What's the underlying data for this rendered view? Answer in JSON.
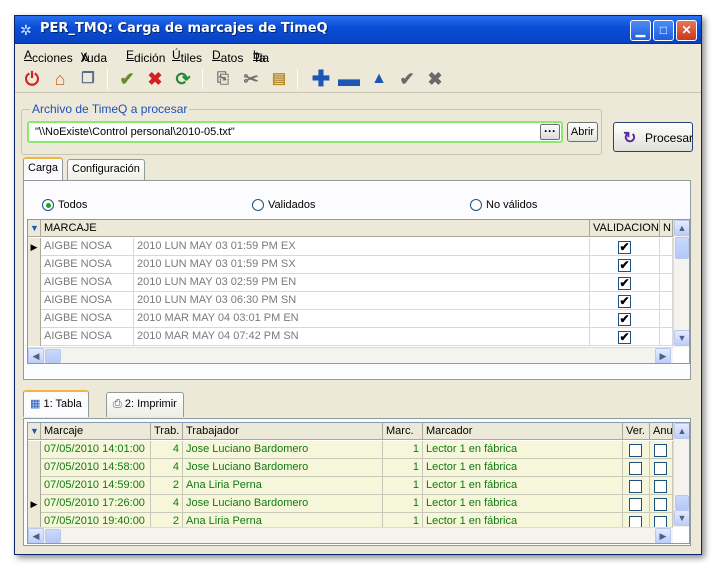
{
  "window": {
    "title": "PER_TMQ: Carga de marcajes de TimeQ"
  },
  "menu": [
    {
      "pre": "",
      "u": "A",
      "post": "cciones"
    },
    {
      "pre": "A",
      "u": "y",
      "post": "uda"
    },
    {
      "pre": "",
      "u": "E",
      "post": "dición"
    },
    {
      "pre": "",
      "u": "Ú",
      "post": "tiles"
    },
    {
      "pre": "",
      "u": "D",
      "post": "atos"
    },
    {
      "pre": "Ta",
      "u": "b",
      "post": "la"
    }
  ],
  "toolbar": [
    "power-icon",
    "home-icon",
    "windows-icon",
    "approve-all-icon",
    "reject-all-icon",
    "refresh-icon",
    "copy-icon",
    "cut-icon",
    "paste-icon",
    "add-icon",
    "remove-icon",
    "up-icon",
    "accept-icon",
    "cancel-icon"
  ],
  "archivo": {
    "label": "Archivo de TimeQ a procesar",
    "path": "\"\\\\NoExiste\\Control personal\\2010-05.txt\"",
    "ellipsis": "···",
    "abrir": "Abrir"
  },
  "procesar": "Procesar",
  "tabs_top": [
    "Carga",
    "Configuración"
  ],
  "filtros": {
    "todos": "Todos",
    "validados": "Validados",
    "no_validos": "No válidos"
  },
  "grid1": {
    "headers": {
      "marcaje": "MARCAJE",
      "validacion": "VALIDACION",
      "n": "N"
    },
    "rows": [
      {
        "nombre": "AIGBE NOSA",
        "fecha": "2010 LUN MAY 03 01:59 PM EX",
        "valid": "✔"
      },
      {
        "nombre": "AIGBE NOSA",
        "fecha": "2010 LUN MAY 03 01:59 PM SX",
        "valid": "✔"
      },
      {
        "nombre": "AIGBE NOSA",
        "fecha": "2010 LUN MAY 03 02:59 PM EN",
        "valid": "✔"
      },
      {
        "nombre": "AIGBE NOSA",
        "fecha": "2010 LUN MAY 03 06:30 PM SN",
        "valid": "✔"
      },
      {
        "nombre": "AIGBE NOSA",
        "fecha": "2010 MAR MAY 04 03:01 PM EN",
        "valid": "✔"
      },
      {
        "nombre": "AIGBE NOSA",
        "fecha": "2010 MAR MAY 04 07:42 PM SN",
        "valid": "✔"
      }
    ]
  },
  "tabs_bottom": [
    "1: Tabla",
    "2: Imprimir"
  ],
  "grid2": {
    "headers": {
      "marcaje": "Marcaje",
      "trab": "Trab.",
      "trabajador": "Trabajador",
      "marc": "Marc.",
      "marcador": "Marcador",
      "ver": "Ver.",
      "anu": "Anu"
    },
    "rows": [
      {
        "marcaje": "07/05/2010 14:01:00",
        "trab": "4",
        "trabajador": "Jose Luciano Bardomero",
        "marc": "1",
        "marcador": "Lector 1 en fábrica"
      },
      {
        "marcaje": "07/05/2010 14:58:00",
        "trab": "4",
        "trabajador": "Jose Luciano Bardomero",
        "marc": "1",
        "marcador": "Lector 1 en fábrica"
      },
      {
        "marcaje": "07/05/2010 14:59:00",
        "trab": "2",
        "trabajador": "Ana Liria Perna",
        "marc": "1",
        "marcador": "Lector 1 en fábrica"
      },
      {
        "marcaje": "07/05/2010 17:26:00",
        "trab": "4",
        "trabajador": "Jose Luciano Bardomero",
        "marc": "1",
        "marcador": "Lector 1 en fábrica"
      },
      {
        "marcaje": "07/05/2010 19:40:00",
        "trab": "2",
        "trabajador": "Ana Liria Perna",
        "marc": "1",
        "marcador": "Lector 1 en fábrica"
      }
    ]
  }
}
